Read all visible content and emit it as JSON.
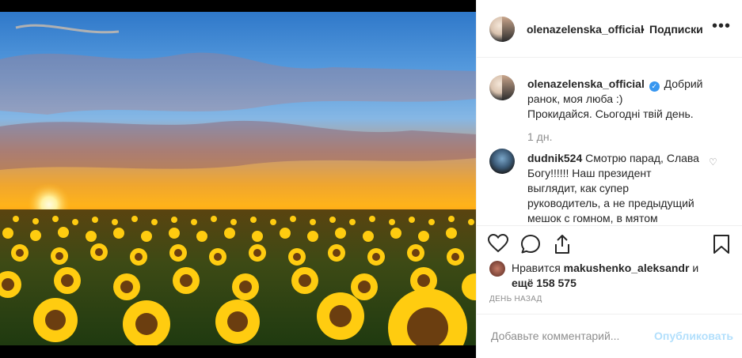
{
  "post": {
    "image_alt": "sunflower field at sunrise",
    "username": "olenazelenska_official",
    "separator": "•",
    "follow_label": "Подписки",
    "more_icon": "more-icon",
    "caption_line1": "Добрий ранок, моя люба :)",
    "caption_line2": "Прокидайся. Сьогодні твій день.",
    "time_ago": "1 дн.",
    "comment": {
      "username": "dudnik524",
      "text": "Смотрю парад, Слава Богу!!!!!! Наш президент выглядит, как супер руководитель, а не предыдущий мешок с гомном, в мятом"
    },
    "likes": {
      "prefix": "Нравится",
      "user": "makushenko_aleksandr",
      "and": "и",
      "rest": "ещё 158 575"
    },
    "date": "ДЕНЬ НАЗАД",
    "add_comment_placeholder": "Добавьте комментарий...",
    "publish_label": "Опубликовать",
    "colors": {
      "accent": "#3897f0",
      "publish_disabled": "#b2dffc",
      "muted": "#8e8e8e"
    }
  }
}
